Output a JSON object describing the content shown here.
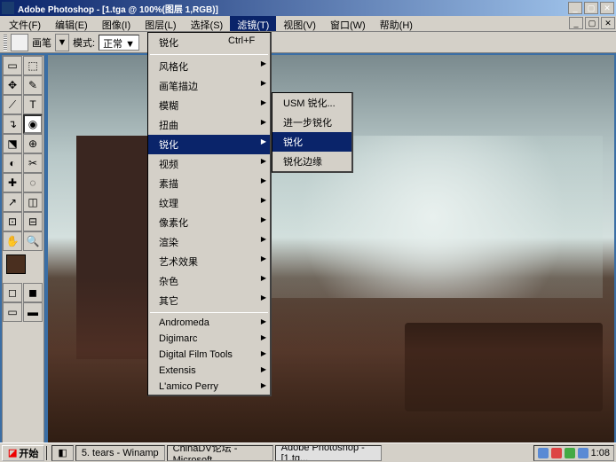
{
  "titlebar": {
    "title": "Adobe Photoshop - [1.tga @ 100%(图层 1,RGB)]"
  },
  "menubar": {
    "items": [
      "文件(F)",
      "编辑(E)",
      "图像(I)",
      "图层(L)",
      "选择(S)",
      "滤镜(T)",
      "视图(V)",
      "窗口(W)",
      "帮助(H)"
    ]
  },
  "optbar": {
    "brushLabel": "画笔",
    "modeLabel": "模式:",
    "modeValue": "正常"
  },
  "filterMenu": {
    "top": {
      "label": "锐化",
      "shortcut": "Ctrl+F"
    },
    "groups": [
      [
        "风格化",
        "画笔描边",
        "模糊",
        "扭曲"
      ],
      [
        "锐化",
        "视频",
        "素描",
        "纹理",
        "像素化",
        "渲染",
        "艺术效果",
        "杂色",
        "其它"
      ],
      [
        "Andromeda",
        "Digimarc",
        "Digital Film Tools",
        "Extensis",
        "L'amico Perry"
      ]
    ],
    "highlightIndex": 0
  },
  "submenu": {
    "items": [
      "USM 锐化...",
      "进一步锐化",
      "锐化",
      "锐化边缘"
    ],
    "highlightIndex": 2
  },
  "taskbar": {
    "start": "开始",
    "tasks": [
      "5. tears - Winamp",
      "ChinaDV论坛 - Microsoft...",
      "Adobe Photoshop - [1.tg..."
    ],
    "time": "1:08"
  },
  "toolbox": {
    "tools": [
      "▭",
      "⬚",
      "✥",
      "✎",
      "⟋",
      "T",
      "↴",
      "◉",
      "⬔",
      "⊕",
      "◐",
      "✂",
      "✚",
      "◌",
      "↗",
      "◫",
      "⊡",
      "⊟",
      "✋",
      "🔍"
    ]
  }
}
